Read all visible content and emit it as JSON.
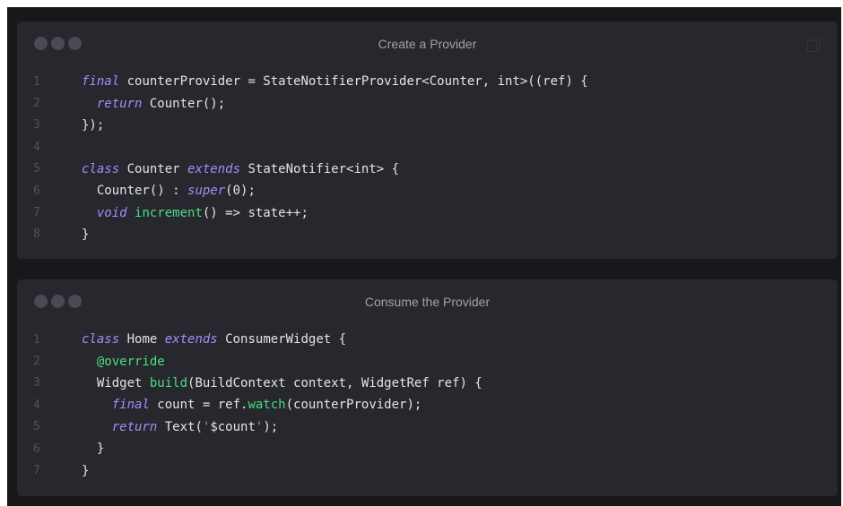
{
  "colors": {
    "background": "#18181b",
    "window": "#27272e",
    "text": "#e4e4e7",
    "keyword": "#a78bfa",
    "function": "#4ade80",
    "string": "#f472b6",
    "line_number": "#52525b"
  },
  "windows": [
    {
      "title": "Create a Provider",
      "icons": [
        "window-dot",
        "window-dot",
        "window-dot",
        "copy-icon"
      ],
      "lines": [
        {
          "n": "1",
          "tokens": [
            {
              "t": "final",
              "c": "kw"
            },
            {
              "t": " counterProvider = StateNotifierProvider<Counter, int>((ref) {",
              "c": ""
            }
          ]
        },
        {
          "n": "2",
          "tokens": [
            {
              "t": "  ",
              "c": ""
            },
            {
              "t": "return",
              "c": "kw"
            },
            {
              "t": " Counter();",
              "c": ""
            }
          ]
        },
        {
          "n": "3",
          "tokens": [
            {
              "t": "});",
              "c": ""
            }
          ]
        },
        {
          "n": "4",
          "tokens": []
        },
        {
          "n": "5",
          "tokens": [
            {
              "t": "class",
              "c": "kw"
            },
            {
              "t": " Counter ",
              "c": ""
            },
            {
              "t": "extends",
              "c": "kw"
            },
            {
              "t": " StateNotifier<int> {",
              "c": ""
            }
          ]
        },
        {
          "n": "6",
          "tokens": [
            {
              "t": "  Counter() : ",
              "c": ""
            },
            {
              "t": "super",
              "c": "kw"
            },
            {
              "t": "(0);",
              "c": ""
            }
          ]
        },
        {
          "n": "7",
          "tokens": [
            {
              "t": "  ",
              "c": ""
            },
            {
              "t": "void",
              "c": "kw"
            },
            {
              "t": " ",
              "c": ""
            },
            {
              "t": "increment",
              "c": "fn"
            },
            {
              "t": "() => state++;",
              "c": ""
            }
          ]
        },
        {
          "n": "8",
          "tokens": [
            {
              "t": "}",
              "c": ""
            }
          ]
        }
      ]
    },
    {
      "title": "Consume the Provider",
      "icons": [
        "window-dot",
        "window-dot",
        "window-dot"
      ],
      "lines": [
        {
          "n": "1",
          "tokens": [
            {
              "t": "class",
              "c": "kw"
            },
            {
              "t": " Home ",
              "c": ""
            },
            {
              "t": "extends",
              "c": "kw"
            },
            {
              "t": " ConsumerWidget {",
              "c": ""
            }
          ]
        },
        {
          "n": "2",
          "tokens": [
            {
              "t": "  ",
              "c": ""
            },
            {
              "t": "@override",
              "c": "fn"
            }
          ]
        },
        {
          "n": "3",
          "tokens": [
            {
              "t": "  Widget ",
              "c": ""
            },
            {
              "t": "build",
              "c": "fn"
            },
            {
              "t": "(BuildContext context, WidgetRef ref) {",
              "c": ""
            }
          ]
        },
        {
          "n": "4",
          "tokens": [
            {
              "t": "    ",
              "c": ""
            },
            {
              "t": "final",
              "c": "kw"
            },
            {
              "t": " count = ref.",
              "c": ""
            },
            {
              "t": "watch",
              "c": "fn"
            },
            {
              "t": "(counterProvider);",
              "c": ""
            }
          ]
        },
        {
          "n": "5",
          "tokens": [
            {
              "t": "    ",
              "c": ""
            },
            {
              "t": "return",
              "c": "kw"
            },
            {
              "t": " Text(",
              "c": ""
            },
            {
              "t": "'",
              "c": "str"
            },
            {
              "t": "$count",
              "c": ""
            },
            {
              "t": "'",
              "c": "str"
            },
            {
              "t": ");",
              "c": ""
            }
          ]
        },
        {
          "n": "6",
          "tokens": [
            {
              "t": "  }",
              "c": ""
            }
          ]
        },
        {
          "n": "7",
          "tokens": [
            {
              "t": "}",
              "c": ""
            }
          ]
        }
      ]
    }
  ]
}
